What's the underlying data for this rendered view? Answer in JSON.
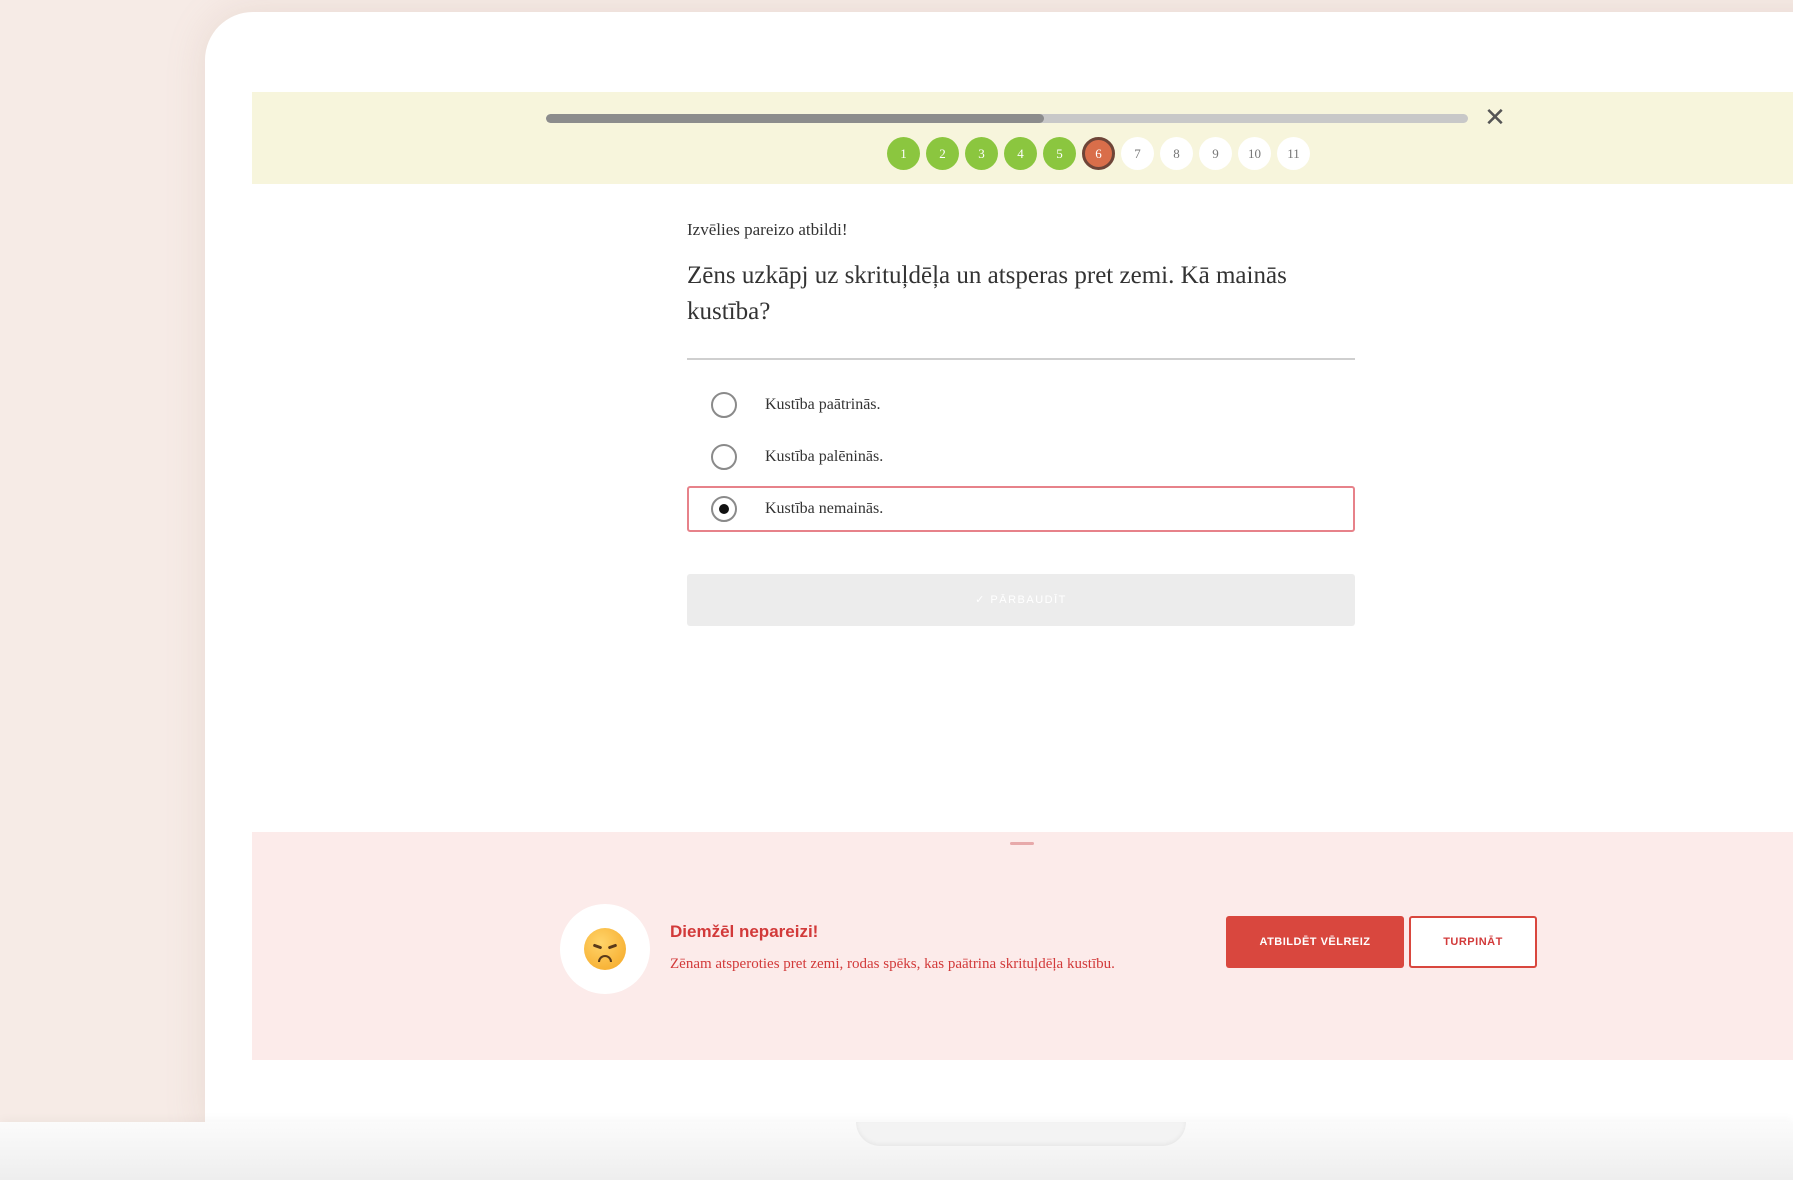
{
  "progress": {
    "value": 0.54
  },
  "close": {
    "label": "✕"
  },
  "steps": [
    {
      "label": "1",
      "state": "done"
    },
    {
      "label": "2",
      "state": "done"
    },
    {
      "label": "3",
      "state": "done"
    },
    {
      "label": "4",
      "state": "done"
    },
    {
      "label": "5",
      "state": "done"
    },
    {
      "label": "6",
      "state": "current"
    },
    {
      "label": "7",
      "state": "todo"
    },
    {
      "label": "8",
      "state": "todo"
    },
    {
      "label": "9",
      "state": "todo"
    },
    {
      "label": "10",
      "state": "todo"
    },
    {
      "label": "11",
      "state": "todo"
    }
  ],
  "quiz": {
    "instruction": "Izvēlies pareizo atbildi!",
    "question": "Zēns uzkāpj uz skrituļdēļa un atsperas pret zemi. Kā mainās kustība?",
    "options": [
      {
        "label": "Kustība paātrinās.",
        "selected": false
      },
      {
        "label": "Kustība palēninās.",
        "selected": false
      },
      {
        "label": "Kustība nemainās.",
        "selected": true
      }
    ],
    "check_label": "✓ PĀRBAUDĪT"
  },
  "feedback": {
    "title": "Diemžēl nepareizi!",
    "text": "Zēnam atsperoties pret zemi, rodas spēks, kas paātrina skrituļdēļa kustību.",
    "retry_label": "ATBILDĒT VĒLREIZ",
    "continue_label": "TURPINĀT",
    "emoji": "disappointed-face"
  },
  "colors": {
    "done": "#8bc63f",
    "current": "#d96e4a",
    "error": "#d9473e",
    "topbar": "#f7f5dc",
    "feedback_bg": "#fcebea"
  }
}
